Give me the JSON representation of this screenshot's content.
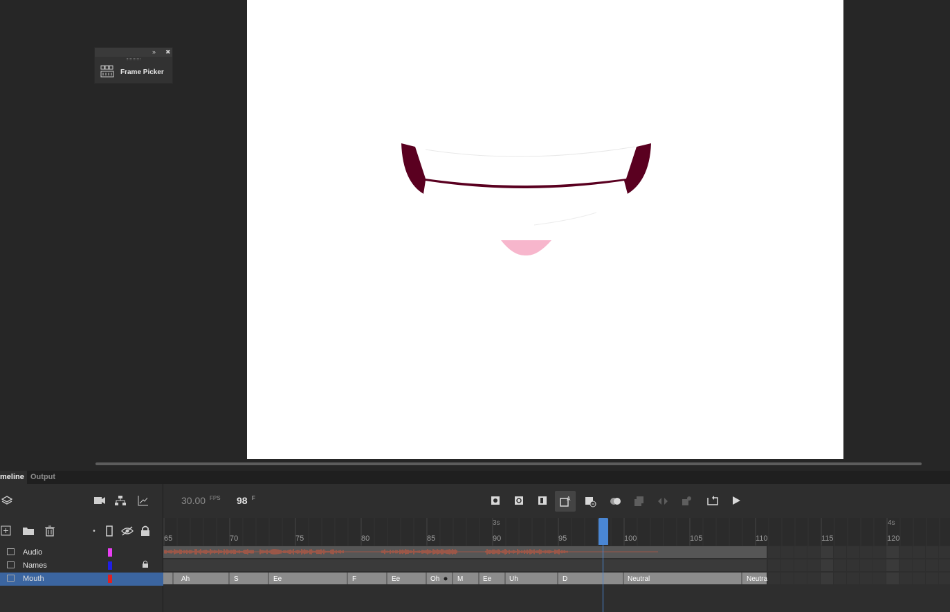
{
  "panel_tabs": {
    "timeline": "meline",
    "output": "Output"
  },
  "frame_picker": {
    "label": "Frame Picker"
  },
  "timeline": {
    "fps_value": "30.00",
    "fps_unit": "FPS",
    "current_frame": "98",
    "frame_unit": "F",
    "ruler_numbers": [
      "65",
      "70",
      "75",
      "80",
      "85",
      "90",
      "95",
      "100",
      "105",
      "110",
      "115",
      "120"
    ],
    "seconds_labels": [
      "3s",
      "4s"
    ],
    "layers": [
      {
        "name": "Audio",
        "color": "#e83ef2",
        "locked": false
      },
      {
        "name": "Names",
        "color": "#1f1fe6",
        "locked": true
      },
      {
        "name": "Mouth",
        "color": "#e02020",
        "locked": false,
        "selected": true
      }
    ],
    "mouth_keyframes": [
      "Ah",
      "S",
      "Ee",
      "F",
      "Ee",
      "Oh",
      "M",
      "Ee",
      "Uh",
      "D",
      "Neutral",
      "Neutra"
    ]
  },
  "colors": {
    "accent": "#4a86d3",
    "lip_dark": "#5a0020",
    "tongue": "#f7b6cc",
    "audio_wave": "#e0583a"
  }
}
